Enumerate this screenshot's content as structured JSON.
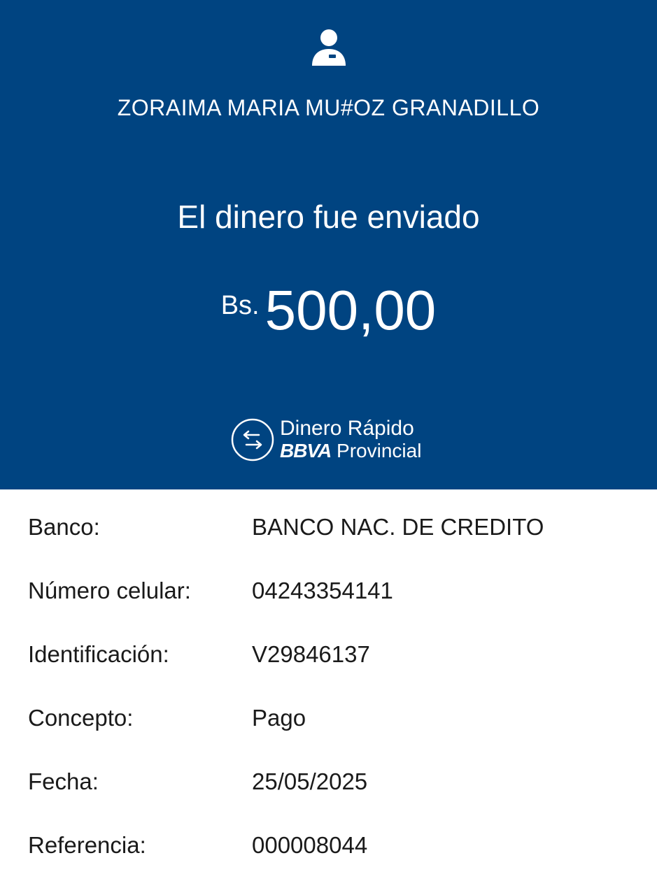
{
  "header": {
    "avatar_icon": "user-icon",
    "recipient_name": "ZORAIMA MARIA MU#OZ GRANADILLO",
    "status_title": "El dinero fue enviado",
    "currency": "Bs.",
    "amount": "500,00",
    "brand_icon": "transfer-arrows-icon",
    "brand_line1": "Dinero Rápido",
    "brand_bank": "BBVA",
    "brand_suffix": "Provincial",
    "background_color": "#004481"
  },
  "details": [
    {
      "label": "Banco:",
      "value": "BANCO NAC. DE CREDITO"
    },
    {
      "label": "Número celular:",
      "value": "04243354141"
    },
    {
      "label": "Identificación:",
      "value": "V29846137"
    },
    {
      "label": "Concepto:",
      "value": "Pago"
    },
    {
      "label": "Fecha:",
      "value": "25/05/2025"
    },
    {
      "label": "Referencia:",
      "value": "000008044"
    }
  ]
}
